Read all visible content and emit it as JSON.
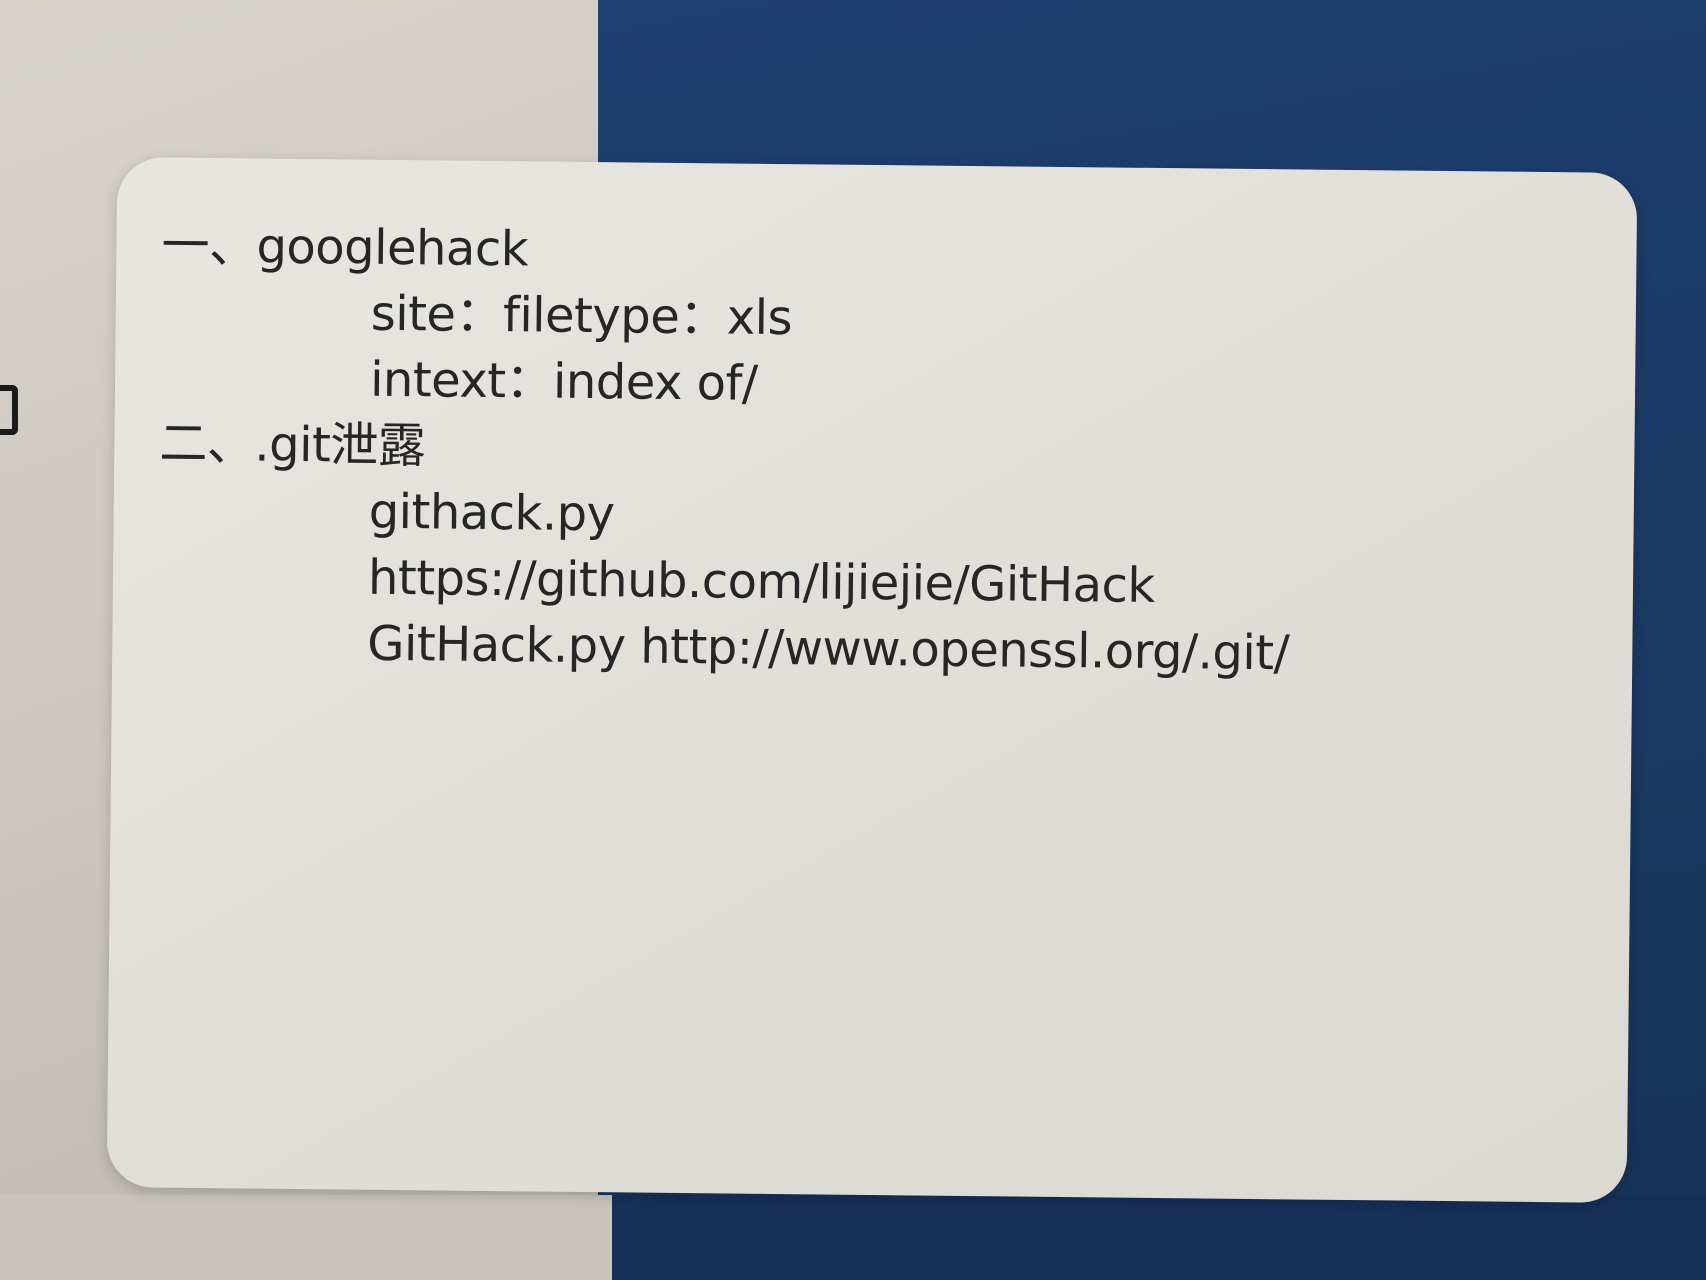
{
  "note": {
    "section1": {
      "heading": "一、googlehack",
      "lines": [
        "site：filetype：xls",
        "intext：index of/"
      ]
    },
    "section2": {
      "heading": "二、.git泄露",
      "lines": [
        "githack.py",
        "https://github.com/lijiejie/GitHack",
        "GitHack.py http://www.openssl.org/.git/"
      ]
    }
  },
  "colors": {
    "background_left": "#cfcac3",
    "background_right": "#1b3a66",
    "card": "#e4e1dc",
    "text": "#262626"
  }
}
